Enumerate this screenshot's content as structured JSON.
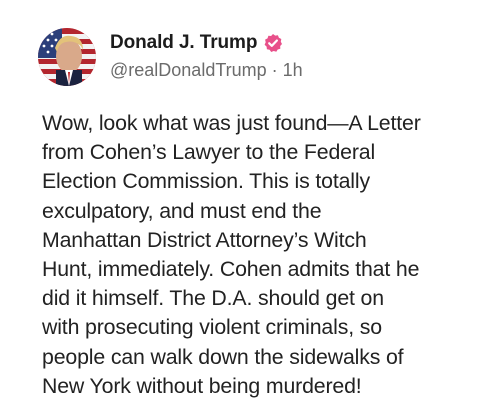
{
  "post": {
    "author": {
      "display_name": "Donald J. Trump",
      "handle": "@realDonaldTrump",
      "separator": "·",
      "timestamp": "1h",
      "verified": true,
      "verified_icon": "verified-badge-icon",
      "verified_color": "#e8508a"
    },
    "body_lines": [
      "Wow, look what was just found—A Letter",
      "from Cohen’s Lawyer to the Federal",
      "Election Commission. This is totally",
      "exculpatory, and must end the",
      "Manhattan District Attorney’s Witch",
      "Hunt, immediately. Cohen admits that he",
      "did it himself. The D.A. should get on",
      "with prosecuting violent criminals, so",
      "people can walk down the sidewalks of",
      "New York without being murdered!"
    ]
  }
}
